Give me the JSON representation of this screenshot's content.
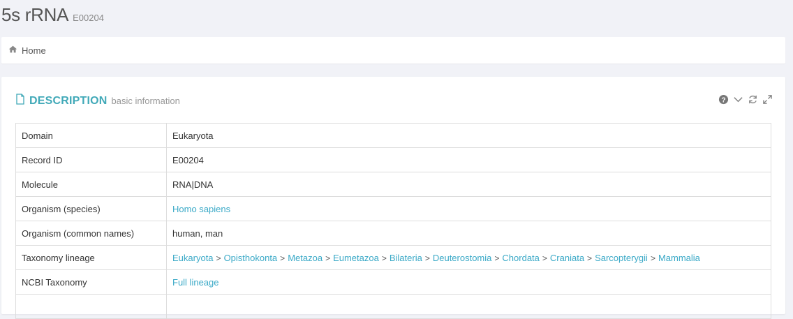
{
  "header": {
    "title": "5s rRNA",
    "record_id": "E00204"
  },
  "breadcrumb": {
    "home_label": "Home"
  },
  "panel": {
    "title": "DESCRIPTION",
    "subtitle": "basic information"
  },
  "rows": {
    "domain": {
      "key": "Domain",
      "value": "Eukaryota"
    },
    "record_id": {
      "key": "Record ID",
      "value": "E00204"
    },
    "molecule": {
      "key": "Molecule",
      "value": "RNA|DNA"
    },
    "species": {
      "key": "Organism (species)",
      "value": "Homo sapiens"
    },
    "common": {
      "key": "Organism (common names)",
      "value": "human, man"
    },
    "lineage": {
      "key": "Taxonomy lineage",
      "items": [
        "Eukaryota",
        "Opisthokonta",
        "Metazoa",
        "Eumetazoa",
        "Bilateria",
        "Deuterostomia",
        "Chordata",
        "Craniata",
        "Sarcopterygii",
        "Mammalia"
      ]
    },
    "ncbi": {
      "key": "NCBI Taxonomy",
      "value": "Full lineage"
    }
  },
  "colors": {
    "accent": "#41a9b8",
    "link": "#3aa9c7",
    "background": "#f1f2f7"
  }
}
